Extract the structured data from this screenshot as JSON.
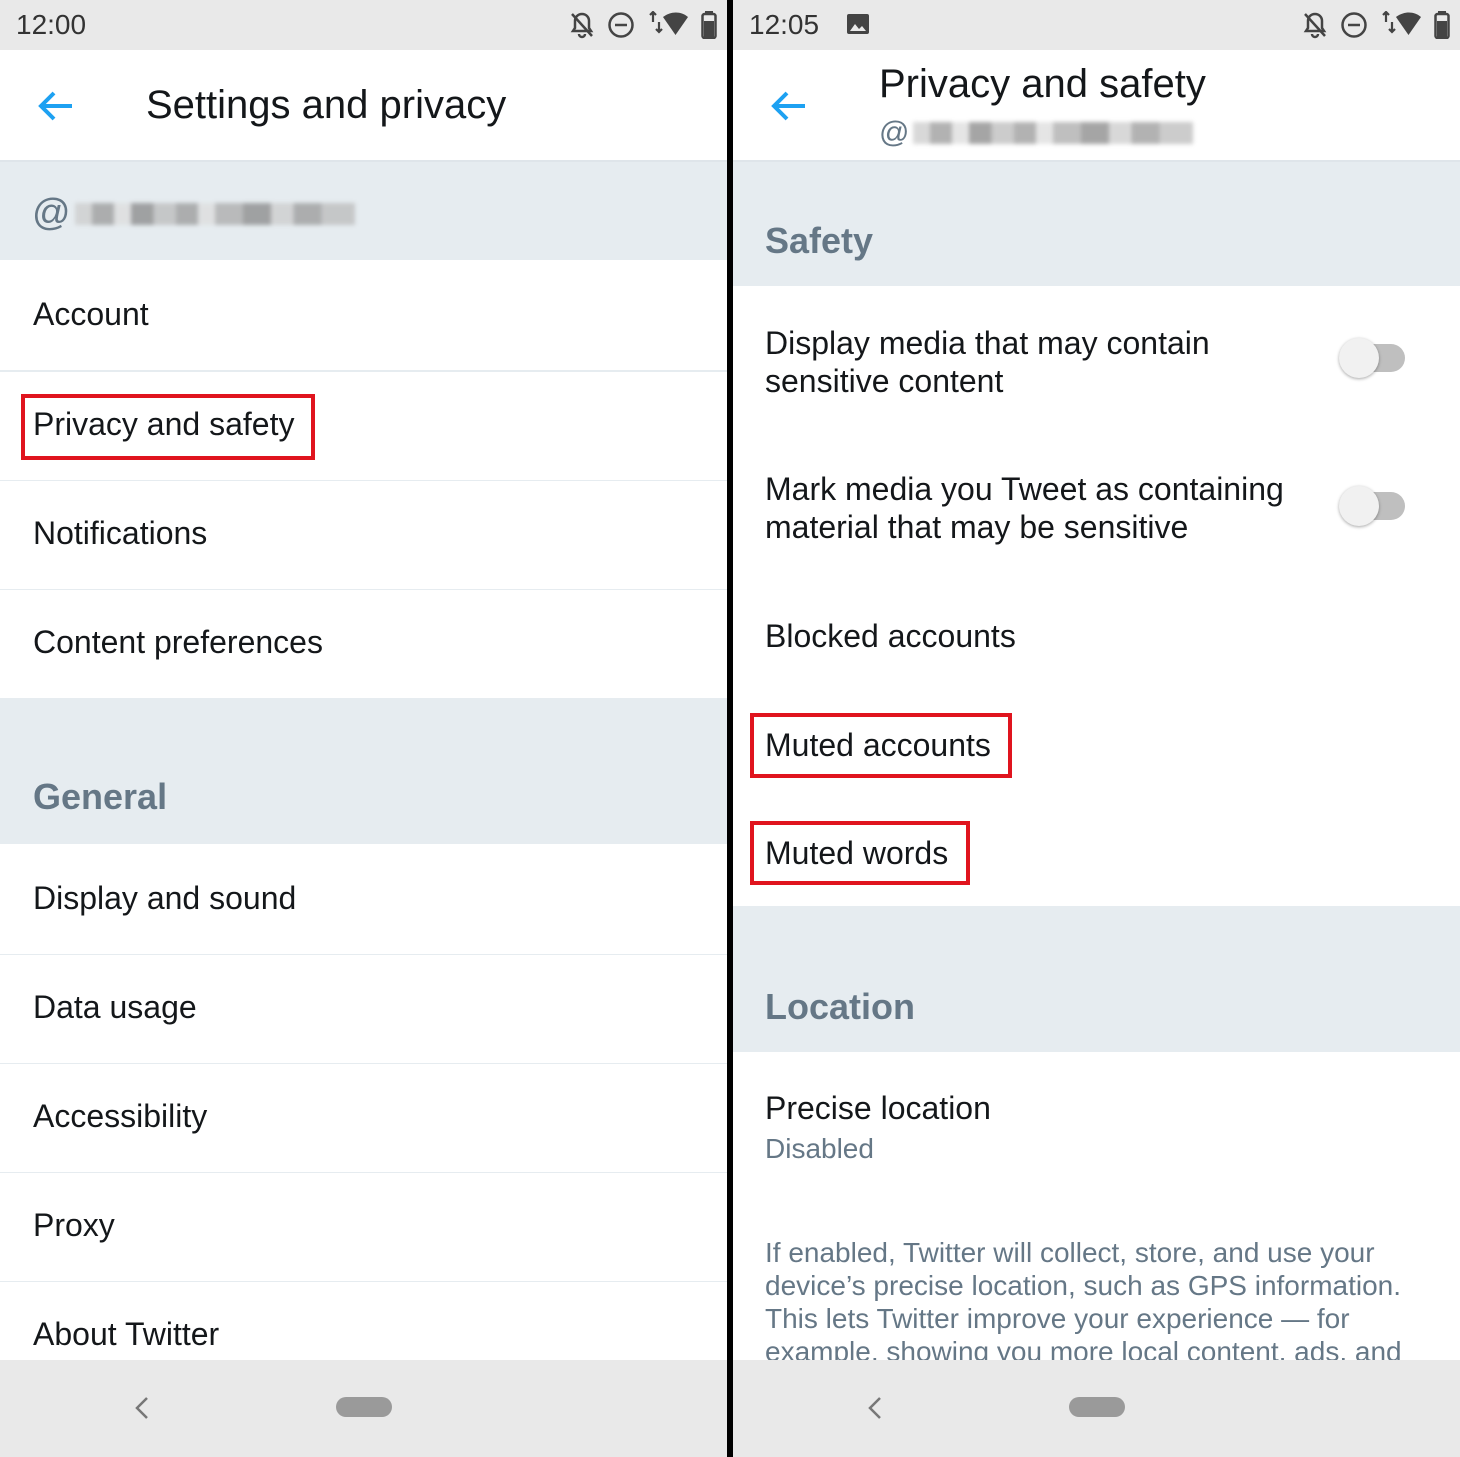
{
  "left": {
    "status": {
      "time": "12:00"
    },
    "title": "Settings and privacy",
    "handle_prefix": "@",
    "menu": [
      {
        "label": "Account"
      },
      {
        "label": "Privacy and safety"
      },
      {
        "label": "Notifications"
      },
      {
        "label": "Content preferences"
      }
    ],
    "general_header": "General",
    "general_menu": [
      {
        "label": "Display and sound"
      },
      {
        "label": "Data usage"
      },
      {
        "label": "Accessibility"
      },
      {
        "label": "Proxy"
      },
      {
        "label": "About Twitter"
      }
    ]
  },
  "right": {
    "status": {
      "time": "12:05"
    },
    "title": "Privacy and safety",
    "handle_prefix": "@",
    "safety_header": "Safety",
    "toggles": [
      {
        "label": "Display media that may contain sensitive content",
        "on": false
      },
      {
        "label": "Mark media you Tweet as containing material that may be sensitive",
        "on": false
      }
    ],
    "items": [
      {
        "label": "Blocked accounts"
      },
      {
        "label": "Muted accounts"
      },
      {
        "label": "Muted words"
      }
    ],
    "location_header": "Location",
    "precise_location": {
      "label": "Precise location",
      "value": "Disabled"
    },
    "location_description": "If enabled, Twitter will collect, store, and use your device’s precise location, such as GPS information. This lets Twitter improve your experience — for example, showing you more local content, ads, and"
  },
  "colors": {
    "accent": "#1da1f2",
    "highlight": "#e0141e",
    "section_text": "#657786",
    "band": "#e6ecf0"
  },
  "icons": [
    "back-arrow-icon",
    "notifications-off-icon",
    "do-not-disturb-icon",
    "wifi-icon",
    "battery-icon",
    "image-icon",
    "nav-back-icon",
    "nav-home-pill"
  ]
}
